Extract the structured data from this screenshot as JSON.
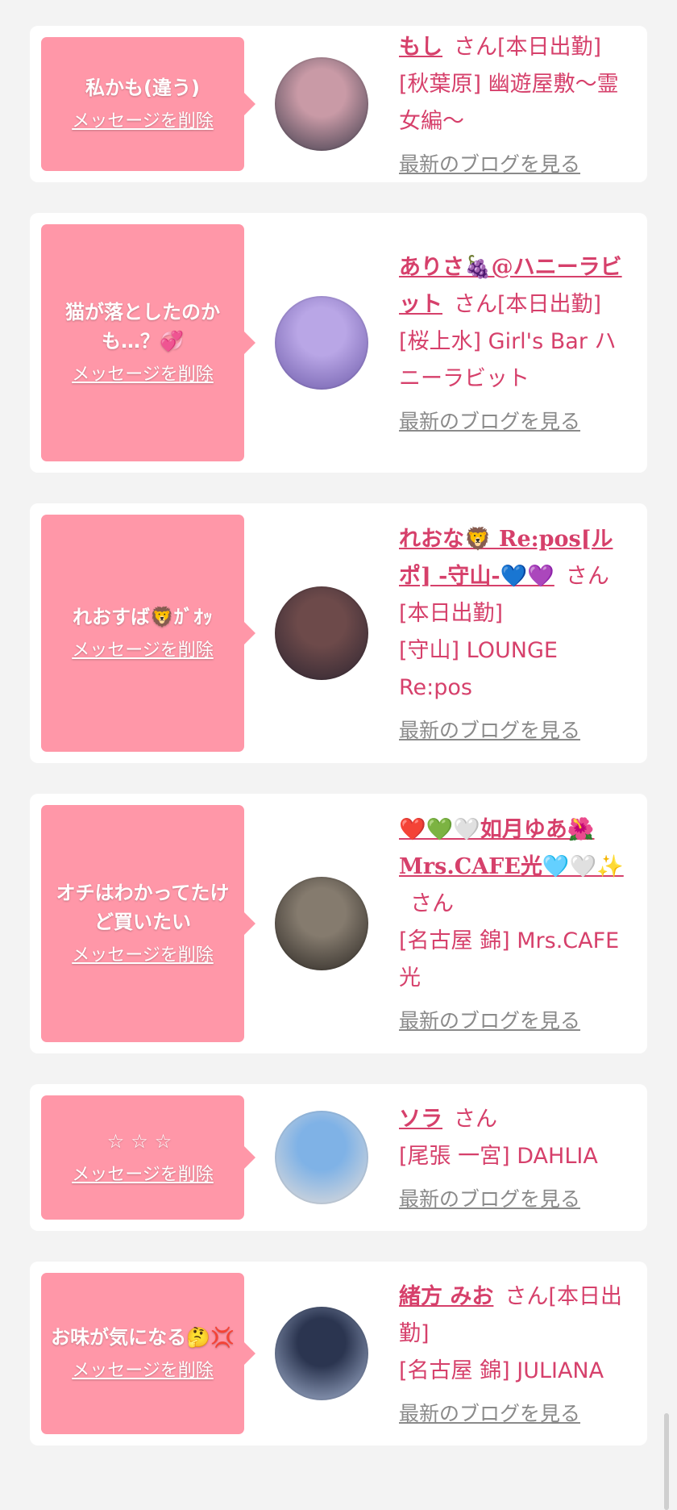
{
  "actions": {
    "delete_label": "メッセージを削除",
    "blog_label": "最新のブログを見る",
    "san_suffix": "さん"
  },
  "items": [
    {
      "message": "私かも(違う)",
      "name": "もし",
      "status": "[本日出勤]",
      "shop": "[秋葉原] 幽遊屋敷〜霊女編〜",
      "avatar_colors": [
        "#c99aa6",
        "#3b3a4a"
      ]
    },
    {
      "message": "猫が落としたのかも…？💞",
      "name": "ありさ🍇@ハニーラビット",
      "status": "[本日出勤]",
      "shop": "[桜上水] Girl's Bar ハニーラビット",
      "avatar_colors": [
        "#b9a6e6",
        "#6c5aa8"
      ]
    },
    {
      "message": "れおすば🦁ｶﾞｵｯ",
      "name": "れおな🦁 Re:pos[ルポ] -守山-💙💜",
      "status": "[本日出勤]",
      "shop": "[守山] LOUNGE Re:pos",
      "avatar_colors": [
        "#6d4a4a",
        "#2c2430"
      ]
    },
    {
      "message": "オチはわかってたけど買いたい",
      "name": "❤️💚🤍如月ゆあ🌺Mrs.CAFE光🩵🤍✨",
      "status": "",
      "shop": "[名古屋 錦] Mrs.CAFE光",
      "avatar_colors": [
        "#857b6e",
        "#2a2622"
      ]
    },
    {
      "message": "☆☆☆",
      "name": "ソラ",
      "status": "",
      "shop": "[尾張 一宮] DAHLIA",
      "avatar_colors": [
        "#7fb2e6",
        "#e9dfd8"
      ]
    },
    {
      "message": "お味が気になる🤔💢",
      "name": "緒方 みお",
      "status": "[本日出勤]",
      "shop": "[名古屋 錦] JULIANA",
      "avatar_colors": [
        "#2b3550",
        "#aab9d6"
      ]
    }
  ]
}
